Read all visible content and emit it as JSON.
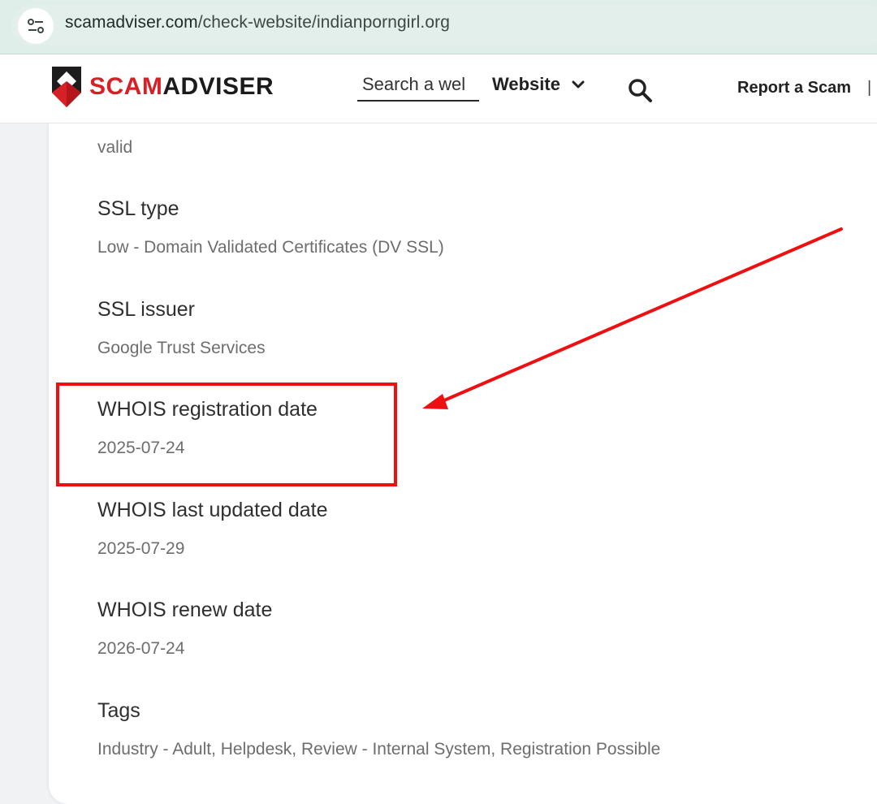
{
  "browser": {
    "url_domain": "scamadviser.com",
    "url_path": "/check-website/indianporngirl.org"
  },
  "header": {
    "logo_scam": "SCAM",
    "logo_adviser": "ADVISER",
    "search_placeholder": "Search a website",
    "search_value": "Search a wel",
    "type_selected": "Website",
    "report_link": "Report a Scam",
    "divider": "|"
  },
  "details": [
    {
      "label": "",
      "value": "valid"
    },
    {
      "label": "SSL type",
      "value": "Low - Domain Validated Certificates (DV SSL)"
    },
    {
      "label": "SSL issuer",
      "value": "Google Trust Services"
    },
    {
      "label": "WHOIS registration date",
      "value": "2025-07-24"
    },
    {
      "label": "WHOIS last updated date",
      "value": "2025-07-29"
    },
    {
      "label": "WHOIS renew date",
      "value": "2026-07-24"
    },
    {
      "label": "Tags",
      "value": "Industry - Adult, Helpdesk, Review - Internal System, Registration Possible"
    }
  ],
  "colors": {
    "brand_red": "#d71f26",
    "annotation_red": "#ee1010",
    "url_bar_bg": "#dfeee9"
  },
  "icons": {
    "site_info": "tune-icon",
    "dropdown": "chevron-down-icon",
    "search": "search-icon",
    "logo": "shield-logo-icon"
  }
}
